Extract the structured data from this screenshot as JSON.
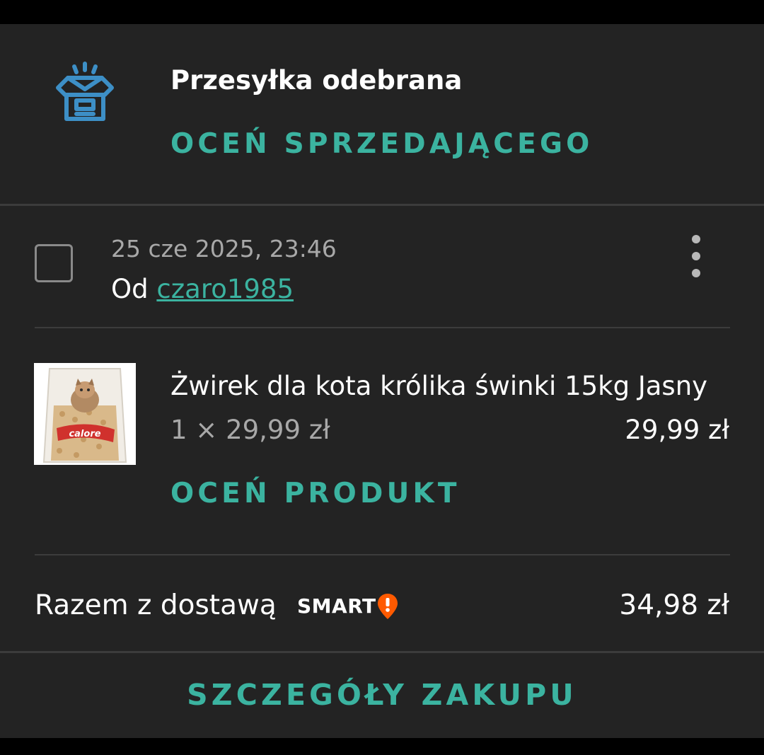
{
  "shipment": {
    "status_icon": "package-received-icon",
    "title": "Przesyłka odebrana",
    "rate_seller_label": "OCEŃ SPRZEDAJĄCEGO"
  },
  "order": {
    "date": "25 cze 2025, 23:46",
    "from_prefix": "Od",
    "seller": "czaro1985",
    "menu_icon": "more-vertical-icon"
  },
  "product": {
    "name": "Żwirek dla kota królika świnki 15kg Jasny",
    "quantity_price": "1 × 29,99 zł",
    "line_total": "29,99 zł",
    "image_brand": "calore",
    "rate_product_label": "OCEŃ PRODUKT"
  },
  "summary": {
    "total_label": "Razem z dostawą",
    "smart_badge": "SMART",
    "total_value": "34,98 zł"
  },
  "footer": {
    "details_label": "SZCZEGÓŁY ZAKUPU"
  },
  "colors": {
    "accent": "#3bb3a0",
    "icon_blue": "#3d8fc6",
    "smart_orange": "#ff5a00",
    "card_bg": "#232323"
  }
}
